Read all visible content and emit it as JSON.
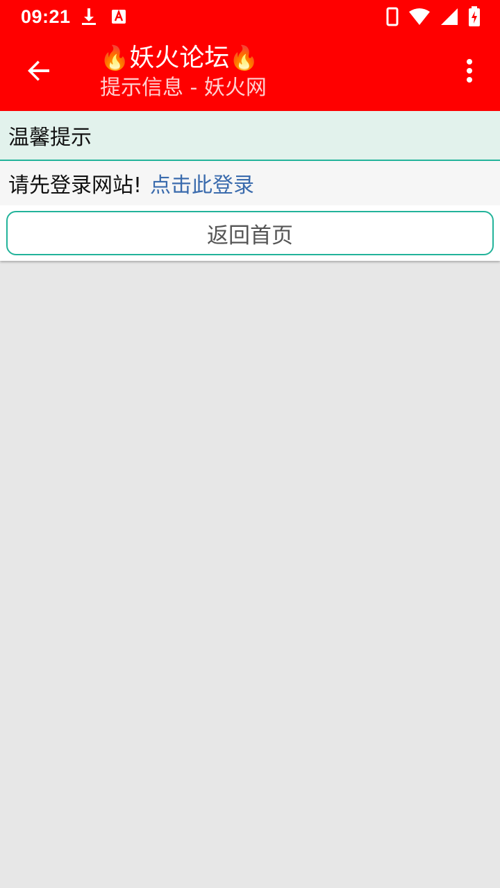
{
  "status_bar": {
    "time": "09:21",
    "icons": [
      "download-icon",
      "app-a-icon",
      "phone-icon",
      "wifi-icon",
      "signal-icon",
      "battery-charging-icon"
    ]
  },
  "app_bar": {
    "back_icon": "arrow-left-icon",
    "flame_left": "🔥",
    "title": "妖火论坛",
    "flame_right": "🔥",
    "subtitle": "提示信息 - 妖火网",
    "overflow_icon": "more-vertical-icon"
  },
  "notice": {
    "header": "温馨提示",
    "message": "请先登录网站!",
    "login_link": "点击此登录",
    "home_button": "返回首页"
  },
  "colors": {
    "brand": "#ff0000",
    "accent_border": "#22b39a",
    "link": "#3a6bad",
    "background": "#e7e7e7"
  }
}
